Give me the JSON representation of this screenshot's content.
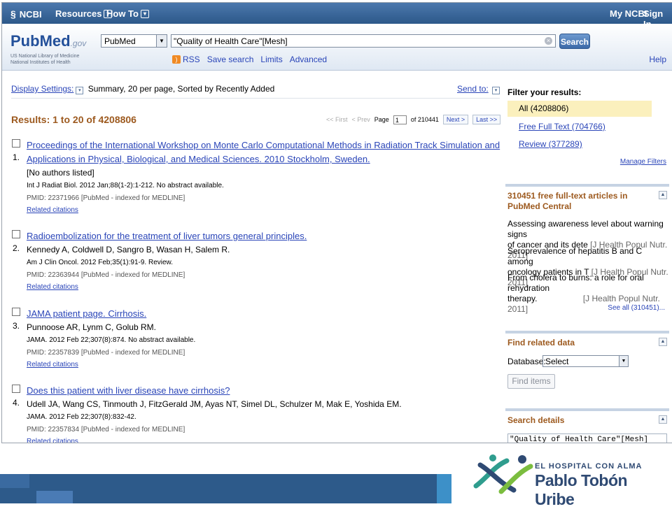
{
  "ncbi_bar": {
    "logo": "NCBI",
    "resources": "Resources",
    "howto": "How To",
    "my_ncbi": "My NCBI",
    "sign_in": "Sign In"
  },
  "search": {
    "logo_pub": "Pub",
    "logo_med": "Med",
    "logo_gov": ".gov",
    "logo_sub1": "US National Library of Medicine",
    "logo_sub2": "National Institutes of Health",
    "database": "PubMed",
    "query": "\"Quality of Health Care\"[Mesh]",
    "button": "Search",
    "links": [
      "RSS",
      "Save search",
      "Limits",
      "Advanced"
    ],
    "help": "Help"
  },
  "display": {
    "label": "Display Settings:",
    "summary": "Summary, 20 per page, Sorted by Recently Added",
    "send_to": "Send to:"
  },
  "results": {
    "count_label": "Results: 1 to 20 of 4208806",
    "pager": {
      "first": "<< First",
      "prev": "< Prev",
      "page_label": "Page",
      "page": "1",
      "of": "of 210441",
      "next": "Next >",
      "last": "Last >>"
    },
    "items": [
      {
        "num": "1.",
        "title": "Proceedings of the International Workshop on Monte Carlo Computational Methods in Radiation Track Simulation and Applications in Physical, Biological, and Medical Sciences. 2010 Stockholm, Sweden.",
        "authors": "[No authors listed]",
        "cite": "Int J Radiat Biol. 2012 Jan;88(1-2):1-212. No abstract available.",
        "pmid": "PMID: 22371966 [PubMed - indexed for MEDLINE]",
        "related": "Related citations"
      },
      {
        "num": "2.",
        "title": "Radioembolization for the treatment of liver tumors general principles.",
        "authors": "Kennedy A, Coldwell D, Sangro B, Wasan H, Salem R.",
        "cite": "Am J Clin Oncol. 2012 Feb;35(1):91-9. Review.",
        "pmid": "PMID: 22363944 [PubMed - indexed for MEDLINE]",
        "related": "Related citations"
      },
      {
        "num": "3.",
        "title": "JAMA patient page. Cirrhosis.",
        "authors": "Punnoose AR, Lynm C, Golub RM.",
        "cite": "JAMA. 2012 Feb 22;307(8):874. No abstract available.",
        "pmid": "PMID: 22357839 [PubMed - indexed for MEDLINE]",
        "related": "Related citations"
      },
      {
        "num": "4.",
        "title": "Does this patient with liver disease have cirrhosis?",
        "authors": "Udell JA, Wang CS, Tinmouth J, FitzGerald JM, Ayas NT, Simel DL, Schulzer M, Mak E, Yoshida EM.",
        "cite": "JAMA. 2012 Feb 22;307(8):832-42.",
        "pmid": "PMID: 22357834 [PubMed - indexed for MEDLINE]",
        "related": "Related citations"
      }
    ]
  },
  "filters": {
    "header": "Filter your results:",
    "all": "All (4208806)",
    "free_full_text": "Free Full Text (704766)",
    "review": "Review (377289)",
    "manage": "Manage Filters"
  },
  "free_fulltext": {
    "header": "310451 free full-text articles in PubMed Central",
    "items": [
      {
        "text1": "Assessing awareness level about warning signs",
        "text2": "of cancer and its dete",
        "journal": "[J Health Popul Nutr. 2011]"
      },
      {
        "text1": "Seroprevalence of hepatitis B and C among",
        "text2": "oncology patients in T",
        "journal": "[J Health Popul Nutr. 2011]"
      },
      {
        "text1": "From cholera to burns: a role for oral rehydration",
        "text2": "therapy.",
        "journal": "[J Health Popul Nutr. 2011]"
      }
    ],
    "see_all": "See all (310451)..."
  },
  "related_data": {
    "header": "Find related data",
    "db_label": "Database:",
    "db_value": "Select",
    "button": "Find items"
  },
  "search_details": {
    "header": "Search details",
    "value": "\"Quality of Health Care\"[Mesh]"
  },
  "hospital": {
    "line1": "EL HOSPITAL CON ALMA",
    "line2": "Pablo Tobón Uribe"
  }
}
